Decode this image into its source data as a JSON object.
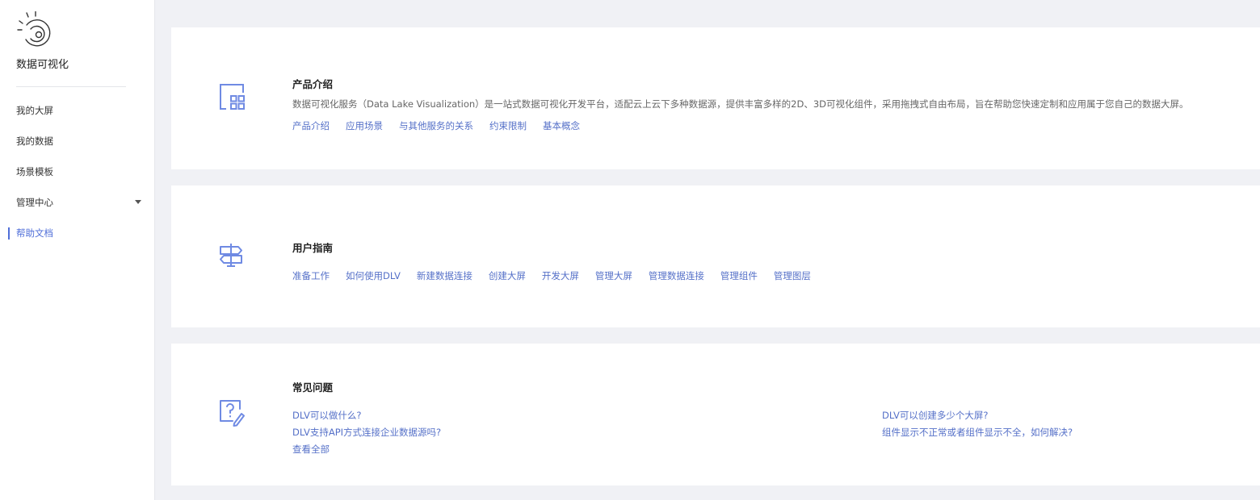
{
  "sidebar": {
    "logo_icon": "eye-sun-icon",
    "app_title": "数据可视化",
    "items": [
      {
        "label": "我的大屏"
      },
      {
        "label": "我的数据"
      },
      {
        "label": "场景模板"
      },
      {
        "label": "管理中心",
        "has_dropdown": true
      },
      {
        "label": "帮助文档",
        "active": true
      }
    ]
  },
  "colors": {
    "accent": "#4f6ed8",
    "link": "#5570c8",
    "background": "#f0f1f5"
  },
  "sections": {
    "intro": {
      "icon": "layout-grid-icon",
      "title": "产品介绍",
      "description": "数据可视化服务（Data Lake Visualization）是一站式数据可视化开发平台，适配云上云下多种数据源，提供丰富多样的2D、3D可视化组件，采用拖拽式自由布局，旨在帮助您快速定制和应用属于您自己的数据大屏。",
      "links": [
        "产品介绍",
        "应用场景",
        "与其他服务的关系",
        "约束限制",
        "基本概念"
      ]
    },
    "guide": {
      "icon": "signpost-icon",
      "title": "用户指南",
      "links": [
        "准备工作",
        "如何使用DLV",
        "新建数据连接",
        "创建大屏",
        "开发大屏",
        "管理大屏",
        "管理数据连接",
        "管理组件",
        "管理图层"
      ]
    },
    "faq": {
      "icon": "question-edit-icon",
      "title": "常见问题",
      "left": [
        "DLV可以做什么?",
        "DLV支持API方式连接企业数据源吗?",
        "查看全部"
      ],
      "right": [
        "DLV可以创建多少个大屏?",
        "组件显示不正常或者组件显示不全，如何解决?"
      ]
    }
  }
}
